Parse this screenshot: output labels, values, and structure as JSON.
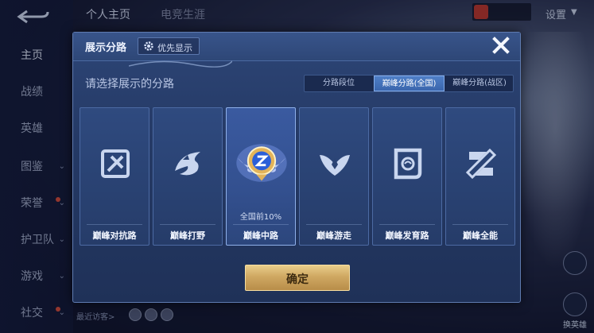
{
  "background": {
    "back_icon": "back-arrow-icon",
    "top_tabs": [
      "个人主页",
      "电竞生涯"
    ],
    "settings_label": "设置",
    "sidebar": [
      {
        "label": "主页",
        "active": true,
        "chevron": false,
        "dot": false
      },
      {
        "label": "战绩",
        "active": false,
        "chevron": false,
        "dot": false
      },
      {
        "label": "英雄",
        "active": false,
        "chevron": false,
        "dot": false
      },
      {
        "label": "图鉴",
        "active": false,
        "chevron": true,
        "dot": false
      },
      {
        "label": "荣誉",
        "active": false,
        "chevron": true,
        "dot": true
      },
      {
        "label": "护卫队",
        "active": false,
        "chevron": true,
        "dot": false
      },
      {
        "label": "游戏",
        "active": false,
        "chevron": true,
        "dot": false
      },
      {
        "label": "社交",
        "active": false,
        "chevron": true,
        "dot": true
      }
    ],
    "visitors_label": "最近访客>",
    "right_actions": [
      "换英雄"
    ]
  },
  "dialog": {
    "title": "展示分路",
    "priority_button": "优先显示",
    "priority_icon": "gear-icon",
    "close_icon": "close-icon",
    "subtitle": "请选择展示的分路",
    "segments": [
      {
        "label": "分路段位",
        "active": false
      },
      {
        "label": "巅峰分路(全国)",
        "active": true
      },
      {
        "label": "巅峰分路(战区)",
        "active": false
      }
    ],
    "lanes": [
      {
        "label": "巅峰对抗路",
        "icon": "clash-lane-icon",
        "rank": "",
        "selected": false
      },
      {
        "label": "巅峰打野",
        "icon": "jungle-icon",
        "rank": "",
        "selected": false
      },
      {
        "label": "巅峰中路",
        "icon": "mid-lane-badge-icon",
        "rank": "全国前10%",
        "selected": true
      },
      {
        "label": "巅峰游走",
        "icon": "roam-icon",
        "rank": "",
        "selected": false
      },
      {
        "label": "巅峰发育路",
        "icon": "farm-lane-icon",
        "rank": "",
        "selected": false
      },
      {
        "label": "巅峰全能",
        "icon": "all-round-icon",
        "rank": "",
        "selected": false
      }
    ],
    "confirm_label": "确定"
  },
  "colors": {
    "accent_blue": "#3a66ad",
    "confirm_gold": "#cfa862",
    "dialog_bg": "#253a66"
  }
}
